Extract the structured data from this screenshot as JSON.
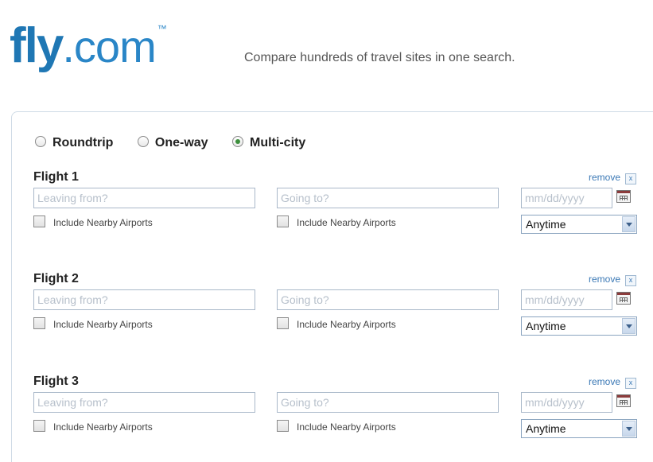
{
  "header": {
    "logo_fly": "fly",
    "logo_dotcom": ".com",
    "logo_tm": "™",
    "tagline": "Compare hundreds of travel sites in one search."
  },
  "trip_types": [
    {
      "label": "Roundtrip",
      "selected": false
    },
    {
      "label": "One-way",
      "selected": false
    },
    {
      "label": "Multi-city",
      "selected": true
    }
  ],
  "flights": [
    {
      "title": "Flight 1",
      "remove_label": "remove",
      "remove_icon": "x",
      "leaving_placeholder": "Leaving from?",
      "going_placeholder": "Going to?",
      "date_placeholder": "mm/dd/yyyy",
      "nearby_label_from": "Include Nearby Airports",
      "nearby_label_to": "Include Nearby Airports",
      "time_value": "Anytime"
    },
    {
      "title": "Flight 2",
      "remove_label": "remove",
      "remove_icon": "x",
      "leaving_placeholder": "Leaving from?",
      "going_placeholder": "Going to?",
      "date_placeholder": "mm/dd/yyyy",
      "nearby_label_from": "Include Nearby Airports",
      "nearby_label_to": "Include Nearby Airports",
      "time_value": "Anytime"
    },
    {
      "title": "Flight 3",
      "remove_label": "remove",
      "remove_icon": "x",
      "leaving_placeholder": "Leaving from?",
      "going_placeholder": "Going to?",
      "date_placeholder": "mm/dd/yyyy",
      "nearby_label_from": "Include Nearby Airports",
      "nearby_label_to": "Include Nearby Airports",
      "time_value": "Anytime"
    }
  ],
  "icons": {
    "calendar": "calendar-icon",
    "dropdown": "chevron-down-icon",
    "radio": "radio-button",
    "checkbox": "checkbox"
  },
  "colors": {
    "brand": "#1f77b4",
    "link": "#3a78b5",
    "field_border": "#a9b8c9"
  }
}
